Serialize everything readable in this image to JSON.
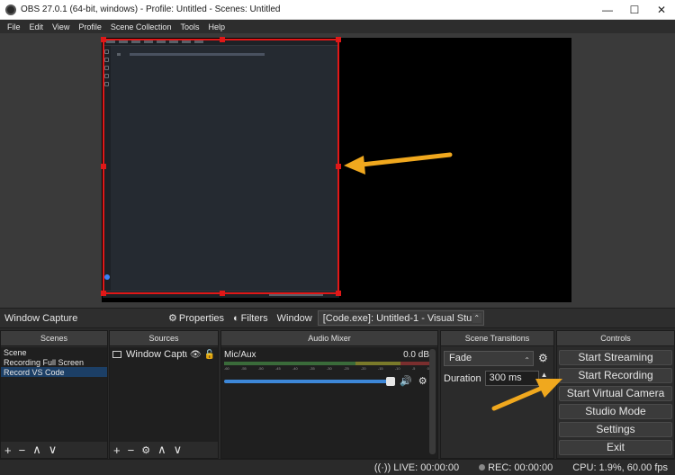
{
  "window": {
    "title": "OBS 27.0.1 (64-bit, windows) - Profile: Untitled - Scenes: Untitled",
    "minimize": "—",
    "maximize": "☐",
    "close": "✕"
  },
  "menu": [
    "File",
    "Edit",
    "View",
    "Profile",
    "Scene Collection",
    "Tools",
    "Help"
  ],
  "source_toolbar": {
    "source_name": "Window Capture",
    "properties_label": "Properties",
    "filters_label": "Filters",
    "window_label": "Window",
    "window_value": "[Code.exe]: Untitled-1 - Visual Stu"
  },
  "scenes": {
    "header": "Scenes",
    "items": [
      "Scene",
      "Recording Full Screen",
      "Record VS Code"
    ],
    "selected": "Record VS Code"
  },
  "sources": {
    "header": "Sources",
    "items": [
      {
        "label": "Window Captu"
      }
    ]
  },
  "audio_mixer": {
    "header": "Audio Mixer",
    "channels": [
      {
        "name": "Mic/Aux",
        "level": "0.0 dB",
        "volume_fraction": 1.0
      }
    ],
    "ticks": [
      "-60",
      "-55",
      "-50",
      "-45",
      "-40",
      "-35",
      "-30",
      "-25",
      "-20",
      "-15",
      "-10",
      "-5",
      "0"
    ]
  },
  "scene_transitions": {
    "header": "Scene Transitions",
    "transition": "Fade",
    "duration_label": "Duration",
    "duration_value": "300 ms"
  },
  "controls": {
    "header": "Controls",
    "buttons": [
      "Start Streaming",
      "Start Recording",
      "Start Virtual Camera",
      "Studio Mode",
      "Settings",
      "Exit"
    ]
  },
  "status": {
    "live": "LIVE: 00:00:00",
    "rec": "REC: 00:00:00",
    "cpu": "CPU: 1.9%, 60.00 fps"
  },
  "colors": {
    "selection_border": "#e01818",
    "annotation_arrow": "#f0a81e",
    "selected_scene": "#1c3f66",
    "volume_slider": "#3d87d8"
  }
}
